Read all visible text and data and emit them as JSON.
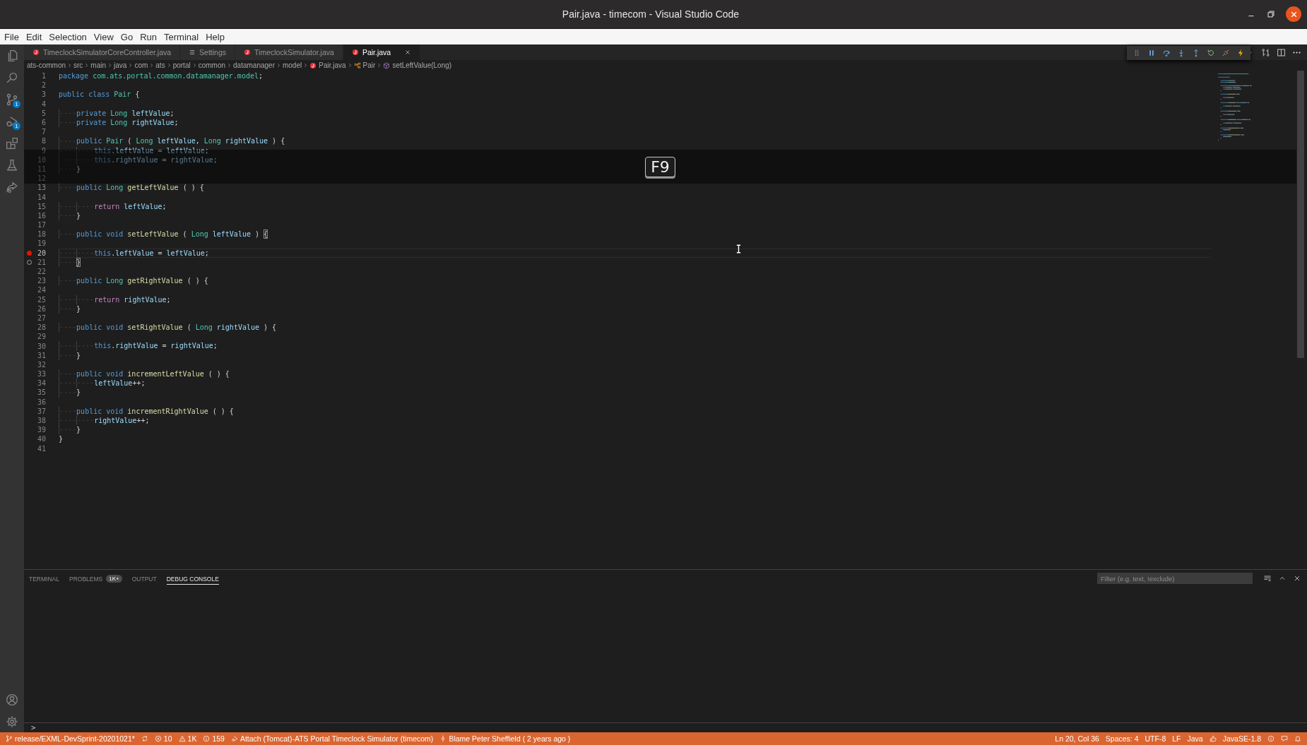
{
  "window": {
    "title": "Pair.java - timecom - Visual Studio Code"
  },
  "menu": [
    "File",
    "Edit",
    "Selection",
    "View",
    "Go",
    "Run",
    "Terminal",
    "Help"
  ],
  "activity_bar": {
    "top": [
      {
        "selected": false
      },
      {
        "selected": false
      },
      {
        "badge": "1",
        "selected": false
      },
      {
        "badge": "1",
        "selected": false
      },
      {
        "selected": false
      },
      {
        "selected": false
      },
      {
        "selected": false
      }
    ],
    "bottom": [
      {
        "selected": false
      },
      {
        "selected": false
      }
    ]
  },
  "tabs": [
    {
      "label": "TimeclockSimulatorCoreController.java",
      "kind": "java",
      "selected": false
    },
    {
      "label": "Settings",
      "kind": "settings",
      "selected": false
    },
    {
      "label": "TimeclockSimulator.java",
      "kind": "java",
      "selected": false
    },
    {
      "label": "Pair.java",
      "kind": "java",
      "selected": true
    }
  ],
  "breadcrumbs": [
    {
      "kind": "folder",
      "text": "ats-common"
    },
    {
      "kind": "folder",
      "text": "src"
    },
    {
      "kind": "folder",
      "text": "main"
    },
    {
      "kind": "folder",
      "text": "java"
    },
    {
      "kind": "folder",
      "text": "com"
    },
    {
      "kind": "folder",
      "text": "ats"
    },
    {
      "kind": "folder",
      "text": "portal"
    },
    {
      "kind": "folder",
      "text": "common"
    },
    {
      "kind": "folder",
      "text": "datamanager"
    },
    {
      "kind": "folder",
      "text": "model"
    },
    {
      "kind": "file",
      "text": "Pair.java"
    },
    {
      "kind": "class",
      "text": "Pair"
    },
    {
      "kind": "method",
      "text": "setLeftValue(Long)"
    }
  ],
  "editor": {
    "key_overlay": {
      "text": "F9"
    },
    "lines": [
      {
        "n": "1",
        "breakpoint": false,
        "tokens": [
          {
            "kind": "kw",
            "text": "package "
          },
          {
            "kind": "pkg",
            "text": "com.ats.portal.common.datamanager.model"
          },
          {
            "kind": "p",
            "text": ";"
          }
        ]
      },
      {
        "n": "2",
        "breakpoint": false
      },
      {
        "n": "3",
        "breakpoint": false,
        "tokens": [
          {
            "kind": "kw",
            "text": "public class "
          },
          {
            "kind": "type",
            "text": "Pair"
          },
          {
            "kind": "p",
            "text": " {"
          }
        ]
      },
      {
        "n": "4",
        "breakpoint": false
      },
      {
        "n": "5",
        "breakpoint": false,
        "tokens": [
          {
            "kind": "kw",
            "text": "    private "
          },
          {
            "kind": "type",
            "text": "Long "
          },
          {
            "kind": "var",
            "text": "leftValue"
          },
          {
            "kind": "p",
            "text": ";"
          }
        ]
      },
      {
        "n": "6",
        "breakpoint": false,
        "tokens": [
          {
            "kind": "kw",
            "text": "    private "
          },
          {
            "kind": "type",
            "text": "Long "
          },
          {
            "kind": "var",
            "text": "rightValue"
          },
          {
            "kind": "p",
            "text": ";"
          }
        ]
      },
      {
        "n": "7",
        "breakpoint": false
      },
      {
        "n": "8",
        "breakpoint": false,
        "tokens": [
          {
            "kind": "kw",
            "text": "    public "
          },
          {
            "kind": "type",
            "text": "Pair"
          },
          {
            "kind": "p",
            "text": " ( "
          },
          {
            "kind": "type",
            "text": "Long "
          },
          {
            "kind": "var",
            "text": "leftValue"
          },
          {
            "kind": "p",
            "text": ", "
          },
          {
            "kind": "type",
            "text": "Long "
          },
          {
            "kind": "var",
            "text": "rightValue"
          },
          {
            "kind": "p",
            "text": " ) {"
          }
        ]
      },
      {
        "n": "9",
        "breakpoint": false,
        "tokens": [
          {
            "kind": "kw",
            "text": "        this"
          },
          {
            "kind": "p",
            "text": "."
          },
          {
            "kind": "var",
            "text": "leftValue"
          },
          {
            "kind": "p",
            "text": " = "
          },
          {
            "kind": "var",
            "text": "leftValue"
          },
          {
            "kind": "p",
            "text": ";"
          }
        ]
      },
      {
        "n": "10",
        "breakpoint": false,
        "tokens": [
          {
            "kind": "kw",
            "text": "        this"
          },
          {
            "kind": "p",
            "text": "."
          },
          {
            "kind": "var",
            "text": "rightValue"
          },
          {
            "kind": "p",
            "text": " = "
          },
          {
            "kind": "var",
            "text": "rightValue"
          },
          {
            "kind": "p",
            "text": ";"
          }
        ]
      },
      {
        "n": "11",
        "breakpoint": false,
        "tokens": [
          {
            "kind": "p",
            "text": "    }"
          }
        ]
      },
      {
        "n": "12",
        "breakpoint": false
      },
      {
        "n": "13",
        "breakpoint": false,
        "tokens": [
          {
            "kind": "kw",
            "text": "    public "
          },
          {
            "kind": "type",
            "text": "Long "
          },
          {
            "kind": "fn",
            "text": "getLeftValue"
          },
          {
            "kind": "p",
            "text": " ( ) {"
          }
        ]
      },
      {
        "n": "14",
        "breakpoint": false
      },
      {
        "n": "15",
        "breakpoint": false,
        "tokens": [
          {
            "kind": "ctl",
            "text": "        return "
          },
          {
            "kind": "var",
            "text": "leftValue"
          },
          {
            "kind": "p",
            "text": ";"
          }
        ]
      },
      {
        "n": "16",
        "breakpoint": false,
        "tokens": [
          {
            "kind": "p",
            "text": "    }"
          }
        ]
      },
      {
        "n": "17",
        "breakpoint": false
      },
      {
        "n": "18",
        "breakpoint": false,
        "tokens": [
          {
            "kind": "kw",
            "text": "    public void "
          },
          {
            "kind": "fn",
            "text": "setLeftValue"
          },
          {
            "kind": "p",
            "text": " ( "
          },
          {
            "kind": "type",
            "text": "Long "
          },
          {
            "kind": "var",
            "text": "leftValue"
          },
          {
            "kind": "p",
            "text": " ) "
          },
          {
            "kind": "bracket-match",
            "text": "{"
          }
        ]
      },
      {
        "n": "19",
        "breakpoint": false
      },
      {
        "n": "20",
        "breakpoint": true,
        "current": true,
        "tokens": [
          {
            "kind": "kw",
            "text": "        this"
          },
          {
            "kind": "p",
            "text": "."
          },
          {
            "kind": "var",
            "text": "leftValue"
          },
          {
            "kind": "p",
            "text": " = "
          },
          {
            "kind": "var",
            "text": "leftValue"
          },
          {
            "kind": "p",
            "text": ";"
          }
        ]
      },
      {
        "n": "21",
        "breakpoint": false,
        "breakpoint_hint": true,
        "tokens": [
          {
            "kind": "bracket-match",
            "text": "    }"
          }
        ]
      },
      {
        "n": "22",
        "breakpoint": false
      },
      {
        "n": "23",
        "breakpoint": false,
        "tokens": [
          {
            "kind": "kw",
            "text": "    public "
          },
          {
            "kind": "type",
            "text": "Long "
          },
          {
            "kind": "fn",
            "text": "getRightValue"
          },
          {
            "kind": "p",
            "text": " ( ) {"
          }
        ]
      },
      {
        "n": "24",
        "breakpoint": false
      },
      {
        "n": "25",
        "breakpoint": false,
        "tokens": [
          {
            "kind": "ctl",
            "text": "        return "
          },
          {
            "kind": "var",
            "text": "rightValue"
          },
          {
            "kind": "p",
            "text": ";"
          }
        ]
      },
      {
        "n": "26",
        "breakpoint": false,
        "tokens": [
          {
            "kind": "p",
            "text": "    }"
          }
        ]
      },
      {
        "n": "27",
        "breakpoint": false
      },
      {
        "n": "28",
        "breakpoint": false,
        "tokens": [
          {
            "kind": "kw",
            "text": "    public void "
          },
          {
            "kind": "fn",
            "text": "setRightValue"
          },
          {
            "kind": "p",
            "text": " ( "
          },
          {
            "kind": "type",
            "text": "Long "
          },
          {
            "kind": "var",
            "text": "rightValue"
          },
          {
            "kind": "p",
            "text": " ) {"
          }
        ]
      },
      {
        "n": "29",
        "breakpoint": false
      },
      {
        "n": "30",
        "breakpoint": false,
        "tokens": [
          {
            "kind": "kw",
            "text": "        this"
          },
          {
            "kind": "p",
            "text": "."
          },
          {
            "kind": "var",
            "text": "rightValue"
          },
          {
            "kind": "p",
            "text": " = "
          },
          {
            "kind": "var",
            "text": "rightValue"
          },
          {
            "kind": "p",
            "text": ";"
          }
        ]
      },
      {
        "n": "31",
        "breakpoint": false,
        "tokens": [
          {
            "kind": "p",
            "text": "    }"
          }
        ]
      },
      {
        "n": "32",
        "breakpoint": false
      },
      {
        "n": "33",
        "breakpoint": false,
        "tokens": [
          {
            "kind": "kw",
            "text": "    public void "
          },
          {
            "kind": "fn",
            "text": "incrementLeftValue"
          },
          {
            "kind": "p",
            "text": " ( ) {"
          }
        ]
      },
      {
        "n": "34",
        "breakpoint": false,
        "tokens": [
          {
            "kind": "var",
            "text": "        leftValue"
          },
          {
            "kind": "p",
            "text": "++;"
          }
        ]
      },
      {
        "n": "35",
        "breakpoint": false,
        "tokens": [
          {
            "kind": "p",
            "text": "    }"
          }
        ]
      },
      {
        "n": "36",
        "breakpoint": false
      },
      {
        "n": "37",
        "breakpoint": false,
        "tokens": [
          {
            "kind": "kw",
            "text": "    public void "
          },
          {
            "kind": "fn",
            "text": "incrementRightValue"
          },
          {
            "kind": "p",
            "text": " ( ) {"
          }
        ]
      },
      {
        "n": "38",
        "breakpoint": false,
        "tokens": [
          {
            "kind": "var",
            "text": "        rightValue"
          },
          {
            "kind": "p",
            "text": "++;"
          }
        ]
      },
      {
        "n": "39",
        "breakpoint": false,
        "tokens": [
          {
            "kind": "p",
            "text": "    }"
          }
        ]
      },
      {
        "n": "40",
        "breakpoint": false,
        "tokens": [
          {
            "kind": "p",
            "text": "}"
          }
        ]
      },
      {
        "n": "41",
        "breakpoint": false
      }
    ]
  },
  "panel": {
    "tabs": [
      {
        "label": "TERMINAL",
        "selected": false
      },
      {
        "label": "PROBLEMS",
        "badge": "1K+",
        "selected": false
      },
      {
        "label": "OUTPUT",
        "selected": false
      },
      {
        "label": "DEBUG CONSOLE",
        "selected": true
      }
    ],
    "filter": {
      "placeholder": "Filter (e.g. text, !exclude)"
    },
    "prompt": ">"
  },
  "status_bar": {
    "left": [
      {
        "kind": "branch",
        "text": "release/EXML-DevSprint-20201021*"
      },
      {
        "kind": "sync"
      },
      {
        "kind": "error",
        "text": "10"
      },
      {
        "kind": "warning",
        "text": "1K"
      },
      {
        "kind": "info",
        "text": "159"
      },
      {
        "kind": "debug",
        "text": "Attach (Tomcat)-ATS Portal Timeclock Simulator (timecom)"
      },
      {
        "kind": "commit",
        "text": "Blame Peter Sheffield ( 2 years ago )"
      }
    ],
    "right": [
      {
        "kind": "text",
        "text": "Ln 20, Col 36"
      },
      {
        "kind": "text",
        "text": "Spaces: 4"
      },
      {
        "kind": "text",
        "text": "UTF-8"
      },
      {
        "kind": "text",
        "text": "LF"
      },
      {
        "kind": "text",
        "text": "Java"
      },
      {
        "kind": "thumbs"
      },
      {
        "kind": "text",
        "text": "JavaSE-1.8"
      },
      {
        "kind": "info"
      },
      {
        "kind": "feedback"
      },
      {
        "kind": "bell"
      }
    ]
  }
}
